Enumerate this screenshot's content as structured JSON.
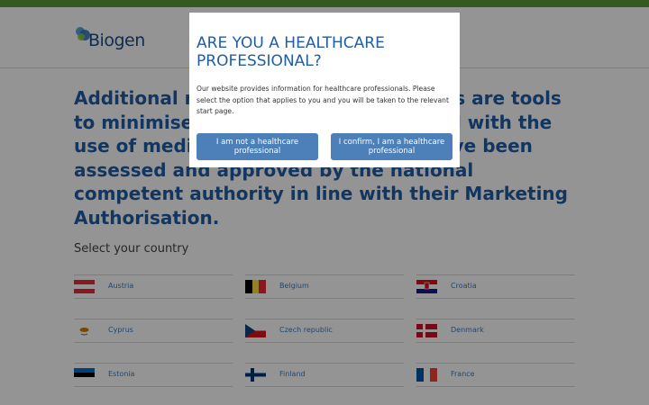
{
  "brand": {
    "name": "Biogen",
    "topbar_color": "#5a9a3a",
    "accent": "#1f5ea6"
  },
  "page": {
    "headline": "Additional risk minimisation measures are tools to minimise potential risks associated with the use of medicines. These materials have been assessed and approved by the national competent authority in line with their Marketing Authorisation.",
    "select_label": "Select your country",
    "countries": [
      {
        "name": "Austria",
        "flag": "austria-flag"
      },
      {
        "name": "Belgium",
        "flag": "belgium-flag"
      },
      {
        "name": "Croatia",
        "flag": "croatia-flag"
      },
      {
        "name": "Cyprus",
        "flag": "cyprus-flag"
      },
      {
        "name": "Czech republic",
        "flag": "czech-flag"
      },
      {
        "name": "Denmark",
        "flag": "denmark-flag"
      },
      {
        "name": "Estonia",
        "flag": "estonia-flag"
      },
      {
        "name": "Finland",
        "flag": "finland-flag"
      },
      {
        "name": "France",
        "flag": "france-flag"
      }
    ]
  },
  "modal": {
    "title": "ARE YOU A HEALTHCARE PROFESSIONAL?",
    "text": "Our website provides information for healthcare professionals. Please select the option that applies to you and you will be taken to the relevant start page.",
    "btn_no": "I am not a healthcare professional",
    "btn_yes": "I confirm, I am a healthcare professional"
  }
}
